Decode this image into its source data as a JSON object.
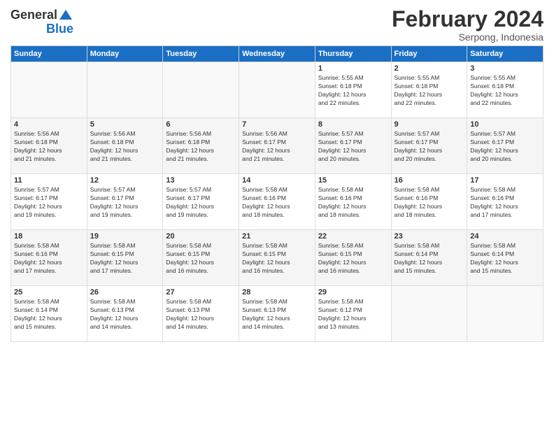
{
  "header": {
    "logo_general": "General",
    "logo_blue": "Blue",
    "month_title": "February 2024",
    "subtitle": "Serpong, Indonesia"
  },
  "calendar": {
    "days_of_week": [
      "Sunday",
      "Monday",
      "Tuesday",
      "Wednesday",
      "Thursday",
      "Friday",
      "Saturday"
    ],
    "weeks": [
      [
        {
          "day": "",
          "info": ""
        },
        {
          "day": "",
          "info": ""
        },
        {
          "day": "",
          "info": ""
        },
        {
          "day": "",
          "info": ""
        },
        {
          "day": "1",
          "info": "Sunrise: 5:55 AM\nSunset: 6:18 PM\nDaylight: 12 hours\nand 22 minutes."
        },
        {
          "day": "2",
          "info": "Sunrise: 5:55 AM\nSunset: 6:18 PM\nDaylight: 12 hours\nand 22 minutes."
        },
        {
          "day": "3",
          "info": "Sunrise: 5:55 AM\nSunset: 6:18 PM\nDaylight: 12 hours\nand 22 minutes."
        }
      ],
      [
        {
          "day": "4",
          "info": "Sunrise: 5:56 AM\nSunset: 6:18 PM\nDaylight: 12 hours\nand 21 minutes."
        },
        {
          "day": "5",
          "info": "Sunrise: 5:56 AM\nSunset: 6:18 PM\nDaylight: 12 hours\nand 21 minutes."
        },
        {
          "day": "6",
          "info": "Sunrise: 5:56 AM\nSunset: 6:18 PM\nDaylight: 12 hours\nand 21 minutes."
        },
        {
          "day": "7",
          "info": "Sunrise: 5:56 AM\nSunset: 6:17 PM\nDaylight: 12 hours\nand 21 minutes."
        },
        {
          "day": "8",
          "info": "Sunrise: 5:57 AM\nSunset: 6:17 PM\nDaylight: 12 hours\nand 20 minutes."
        },
        {
          "day": "9",
          "info": "Sunrise: 5:57 AM\nSunset: 6:17 PM\nDaylight: 12 hours\nand 20 minutes."
        },
        {
          "day": "10",
          "info": "Sunrise: 5:57 AM\nSunset: 6:17 PM\nDaylight: 12 hours\nand 20 minutes."
        }
      ],
      [
        {
          "day": "11",
          "info": "Sunrise: 5:57 AM\nSunset: 6:17 PM\nDaylight: 12 hours\nand 19 minutes."
        },
        {
          "day": "12",
          "info": "Sunrise: 5:57 AM\nSunset: 6:17 PM\nDaylight: 12 hours\nand 19 minutes."
        },
        {
          "day": "13",
          "info": "Sunrise: 5:57 AM\nSunset: 6:17 PM\nDaylight: 12 hours\nand 19 minutes."
        },
        {
          "day": "14",
          "info": "Sunrise: 5:58 AM\nSunset: 6:16 PM\nDaylight: 12 hours\nand 18 minutes."
        },
        {
          "day": "15",
          "info": "Sunrise: 5:58 AM\nSunset: 6:16 PM\nDaylight: 12 hours\nand 18 minutes."
        },
        {
          "day": "16",
          "info": "Sunrise: 5:58 AM\nSunset: 6:16 PM\nDaylight: 12 hours\nand 18 minutes."
        },
        {
          "day": "17",
          "info": "Sunrise: 5:58 AM\nSunset: 6:16 PM\nDaylight: 12 hours\nand 17 minutes."
        }
      ],
      [
        {
          "day": "18",
          "info": "Sunrise: 5:58 AM\nSunset: 6:16 PM\nDaylight: 12 hours\nand 17 minutes."
        },
        {
          "day": "19",
          "info": "Sunrise: 5:58 AM\nSunset: 6:15 PM\nDaylight: 12 hours\nand 17 minutes."
        },
        {
          "day": "20",
          "info": "Sunrise: 5:58 AM\nSunset: 6:15 PM\nDaylight: 12 hours\nand 16 minutes."
        },
        {
          "day": "21",
          "info": "Sunrise: 5:58 AM\nSunset: 6:15 PM\nDaylight: 12 hours\nand 16 minutes."
        },
        {
          "day": "22",
          "info": "Sunrise: 5:58 AM\nSunset: 6:15 PM\nDaylight: 12 hours\nand 16 minutes."
        },
        {
          "day": "23",
          "info": "Sunrise: 5:58 AM\nSunset: 6:14 PM\nDaylight: 12 hours\nand 15 minutes."
        },
        {
          "day": "24",
          "info": "Sunrise: 5:58 AM\nSunset: 6:14 PM\nDaylight: 12 hours\nand 15 minutes."
        }
      ],
      [
        {
          "day": "25",
          "info": "Sunrise: 5:58 AM\nSunset: 6:14 PM\nDaylight: 12 hours\nand 15 minutes."
        },
        {
          "day": "26",
          "info": "Sunrise: 5:58 AM\nSunset: 6:13 PM\nDaylight: 12 hours\nand 14 minutes."
        },
        {
          "day": "27",
          "info": "Sunrise: 5:58 AM\nSunset: 6:13 PM\nDaylight: 12 hours\nand 14 minutes."
        },
        {
          "day": "28",
          "info": "Sunrise: 5:58 AM\nSunset: 6:13 PM\nDaylight: 12 hours\nand 14 minutes."
        },
        {
          "day": "29",
          "info": "Sunrise: 5:58 AM\nSunset: 6:12 PM\nDaylight: 12 hours\nand 13 minutes."
        },
        {
          "day": "",
          "info": ""
        },
        {
          "day": "",
          "info": ""
        }
      ]
    ]
  }
}
